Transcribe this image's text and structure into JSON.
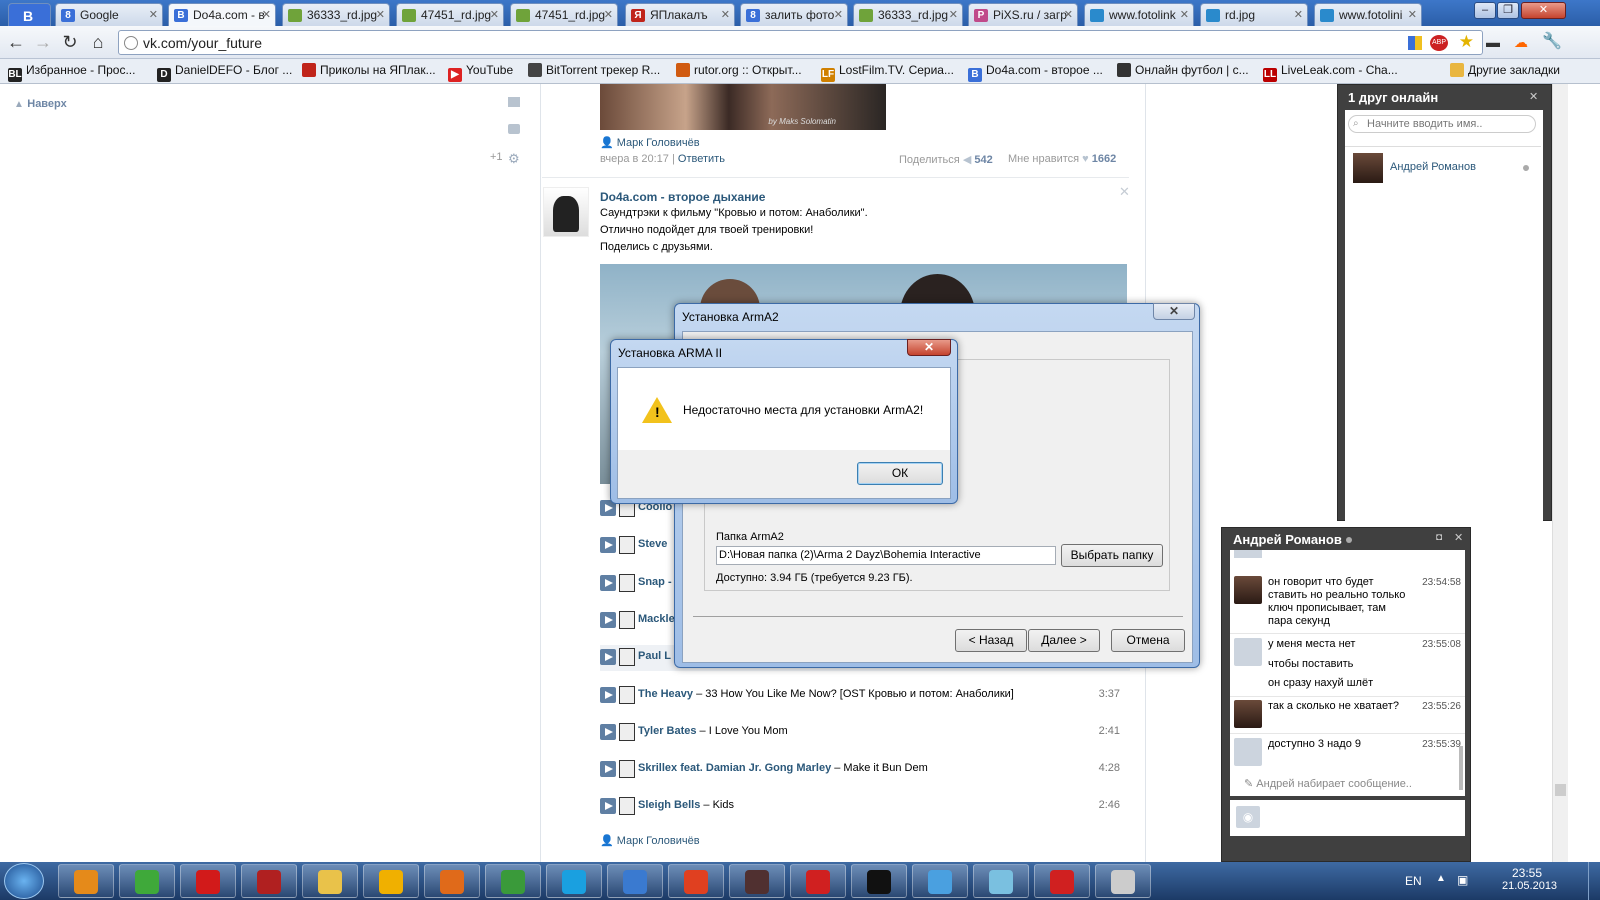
{
  "browser": {
    "tabs": [
      {
        "label": "Google",
        "color": "#3a6fd8",
        "icon": "8"
      },
      {
        "label": "Do4a.com - в",
        "color": "#3a6fd8",
        "icon": "B"
      },
      {
        "label": "36333_rd.jpg",
        "color": "#6fa33a",
        "icon": ""
      },
      {
        "label": "47451_rd.jpg",
        "color": "#6fa33a",
        "icon": ""
      },
      {
        "label": "47451_rd.jpg",
        "color": "#6fa33a",
        "icon": ""
      },
      {
        "label": "ЯПлакалъ",
        "color": "#c0241a",
        "icon": "Я"
      },
      {
        "label": "залить фото",
        "color": "#3a6fd8",
        "icon": "8"
      },
      {
        "label": "36333_rd.jpg",
        "color": "#6fa33a",
        "icon": ""
      },
      {
        "label": "PiXS.ru / загр",
        "color": "#c04a8a",
        "icon": "P"
      },
      {
        "label": "www.fotolink",
        "color": "#2a8acc",
        "icon": ""
      },
      {
        "label": "rd.jpg",
        "color": "#2a8acc",
        "icon": ""
      },
      {
        "label": "www.fotolini",
        "color": "#2a8acc",
        "icon": ""
      }
    ],
    "first_tab_icon": "B",
    "url": "vk.com/your_future",
    "bookmarks": [
      {
        "label": "Избранное - Прос...",
        "icon": "BL",
        "color": "#222"
      },
      {
        "label": "DanielDEFO - Блог ...",
        "icon": "D",
        "color": "#222"
      },
      {
        "label": "Приколы на ЯПлак...",
        "icon": "",
        "color": "#c0241a"
      },
      {
        "label": "YouTube",
        "icon": "▶",
        "color": "#d22"
      },
      {
        "label": "BitTorrent трекер R...",
        "icon": "",
        "color": "#444"
      },
      {
        "label": "rutor.org :: Открыт...",
        "icon": "",
        "color": "#d05a10"
      },
      {
        "label": "LostFilm.TV. Сериа...",
        "icon": "LF",
        "color": "#d08000"
      },
      {
        "label": "Do4a.com - второе ...",
        "icon": "B",
        "color": "#3a6fd8"
      },
      {
        "label": "Онлайн футбол | с...",
        "icon": "",
        "color": "#333"
      },
      {
        "label": "LiveLeak.com - Cha...",
        "icon": "LL",
        "color": "#b00"
      }
    ],
    "other_bookmarks": "Другие закладки",
    "abp": "ABP"
  },
  "left": {
    "back_to_top": "Наверх",
    "counter": "+1"
  },
  "post1": {
    "author": "Марк Головичёв",
    "time": "вчера в 20:17",
    "reply": "Ответить",
    "share_label": "Поделиться",
    "share_count": "542",
    "like_label": "Мне нравится",
    "like_count": "1662",
    "image_caption": "by Maks Solomatin"
  },
  "post2": {
    "group": "Do4a.com - второе дыхание",
    "lines": [
      "Саундтрэки к фильму \"Кровью и потом: Анаболики\".",
      "Отлично подойдет для твоей тренировки!",
      "Поделись с друзьями."
    ]
  },
  "tracks": [
    {
      "artist": "Coolio",
      "title": "",
      "duration": ""
    },
    {
      "artist": "Steve",
      "title": "",
      "duration": ""
    },
    {
      "artist": "Snap -",
      "title": "",
      "duration": ""
    },
    {
      "artist": "Mackle",
      "title": "",
      "duration": ""
    },
    {
      "artist": "Paul L",
      "title": "",
      "duration": ""
    },
    {
      "artist": "The Heavy",
      "title": " – 33 How You Like Me Now? [OST Кровью и потом: Анаболики]",
      "duration": "3:37"
    },
    {
      "artist": "Tyler Bates",
      "title": " – I Love You Mom",
      "duration": "2:41"
    },
    {
      "artist": "Skrillex feat. Damian Jr. Gong Marley",
      "title": " – Make it Bun Dem",
      "duration": "4:28"
    },
    {
      "artist": "Sleigh Bells",
      "title": " – Kids",
      "duration": "2:46"
    }
  ],
  "bottom_author": "Марк Головичёв",
  "installer": {
    "title": "Установка ArmA2",
    "folder_label": "Папка ArmA2",
    "folder_path": "D:\\Новая папка (2)\\Arma 2 Dayz\\Bohemia Interactive",
    "browse": "Выбрать папку",
    "space": "Доступно: 3.94 ГБ (требуется  9.23 ГБ).",
    "back": "< Назад",
    "next": "Далее >",
    "cancel": "Отмена"
  },
  "alert": {
    "title": "Установка ARMA II",
    "message": "Недостаточно места для установки ArmA2!",
    "ok": "ОК"
  },
  "friends": {
    "header": "1 друг онлайн",
    "search_placeholder": "Начните вводить имя..",
    "friend_name": "Андрей Романов"
  },
  "chat": {
    "title": "Андрей Романов",
    "messages": [
      {
        "text": "он говорит что будет ставить но реально только ключ прописывает, там пара секунд",
        "time": "23:54:58",
        "avatar": "friend"
      },
      {
        "text": "у меня места нет",
        "time": "23:55:08",
        "avatar": "me"
      },
      {
        "text": "чтобы поставить",
        "time": "",
        "avatar": "none"
      },
      {
        "text": "он сразу нахуй шлёт",
        "time": "",
        "avatar": "none"
      },
      {
        "text": "так а сколько не хватает?",
        "time": "23:55:26",
        "avatar": "friend"
      },
      {
        "text": "доступно 3 надо 9",
        "time": "23:55:39",
        "avatar": "me"
      }
    ],
    "typing": "Андрей набирает сообщение.."
  },
  "taskbar": {
    "lang": "EN",
    "time": "23:55",
    "date": "21.05.2013"
  }
}
